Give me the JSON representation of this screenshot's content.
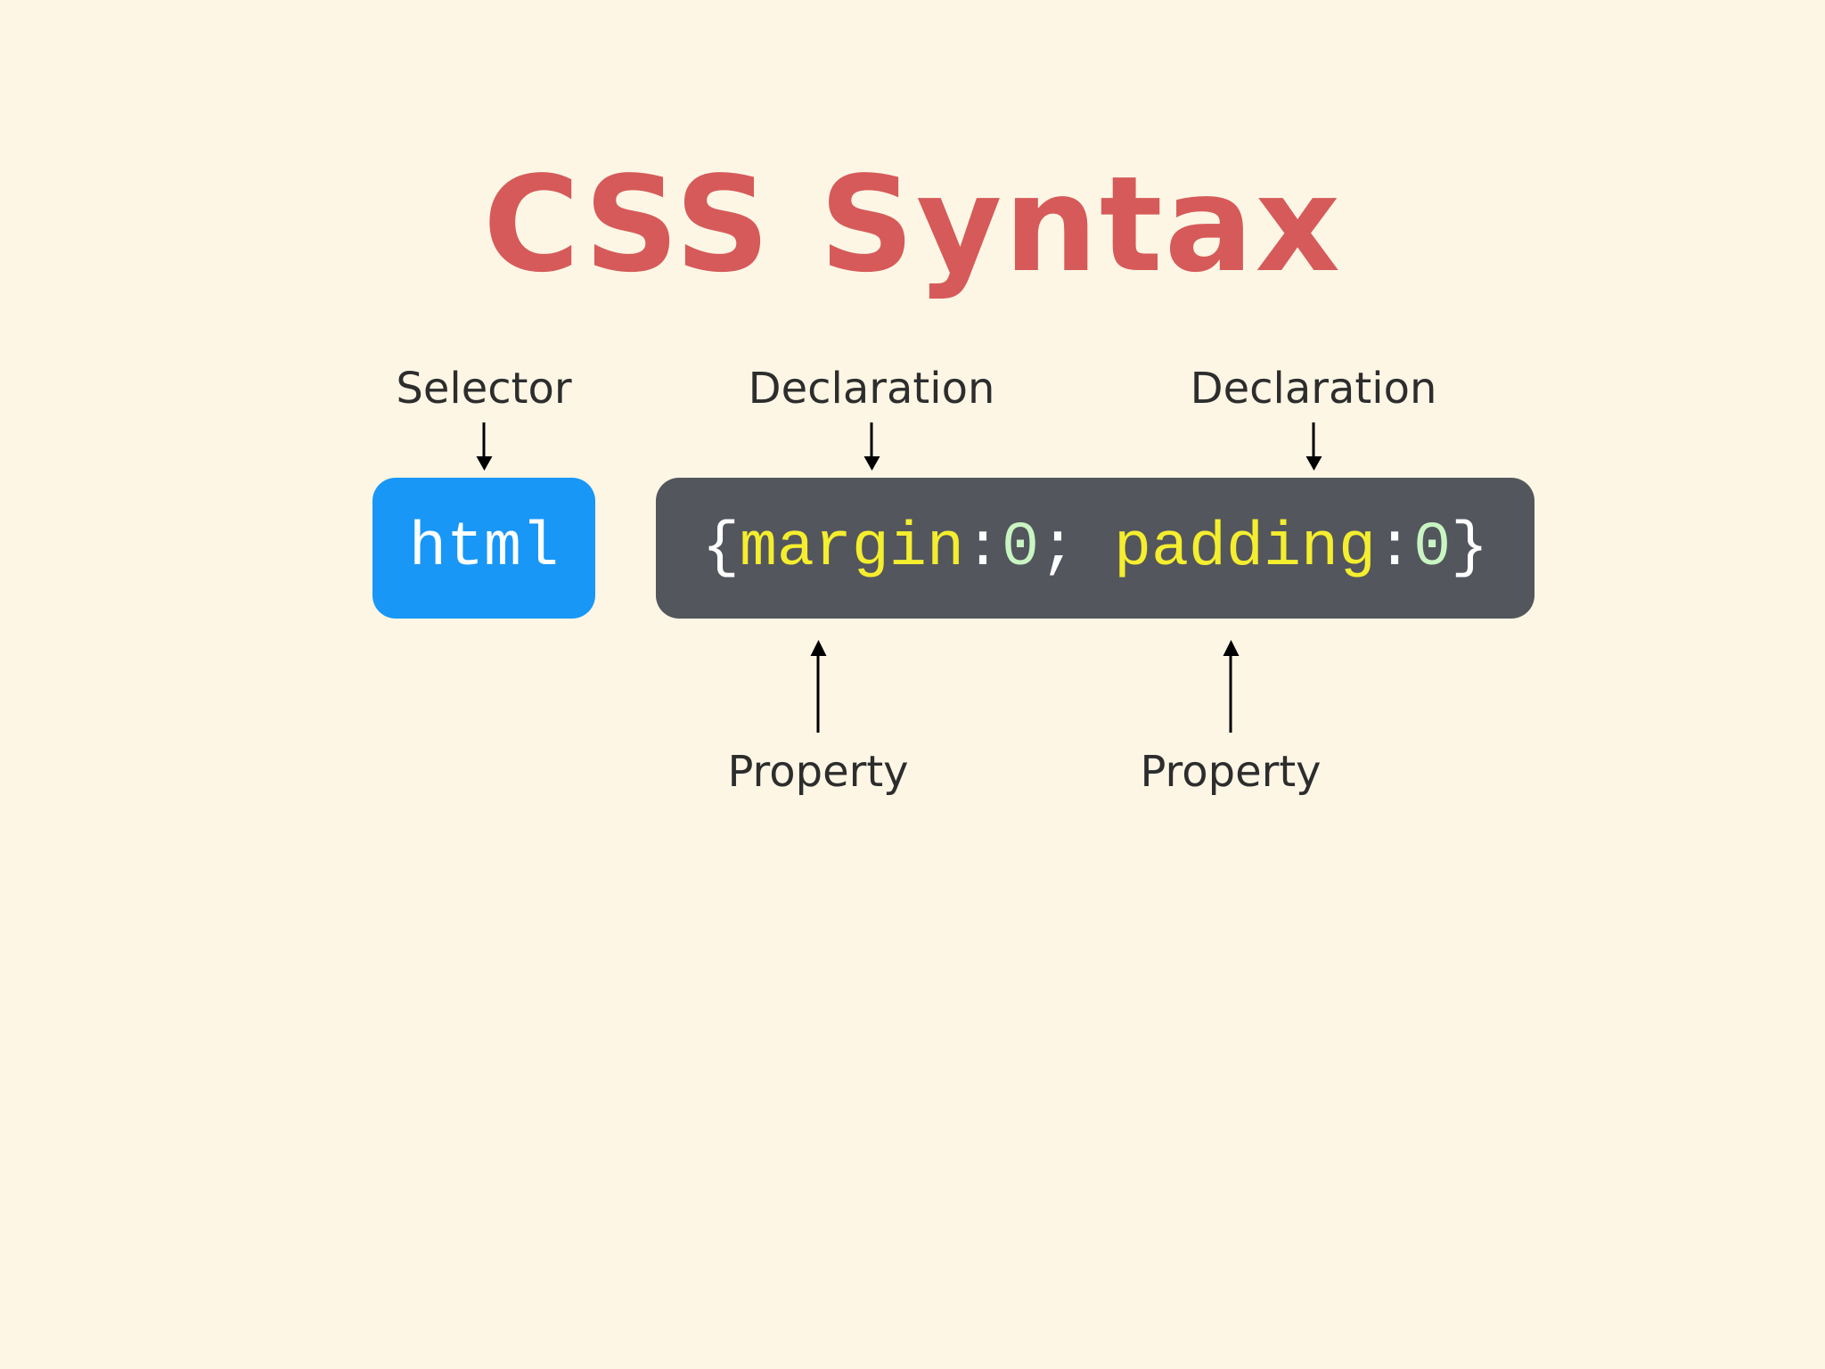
{
  "title": "CSS Syntax",
  "labels": {
    "selector": "Selector",
    "declaration_1": "Declaration",
    "declaration_2": "Declaration",
    "property_1": "Property",
    "property_2": "Property"
  },
  "selector_code": "html",
  "declaration_code": {
    "open_brace": "{",
    "property_1": "margin",
    "colon_1": ":",
    "value_1": "0",
    "semicolon": "; ",
    "property_2": "padding",
    "colon_2": ":",
    "value_2": "0",
    "close_brace": "}"
  },
  "colors": {
    "background": "#fdf6e5",
    "title": "#d65a59",
    "selector_box": "#1897f7",
    "code_box": "#53565d",
    "property_text": "#f5ee2e",
    "value_text": "#c9f5c3"
  }
}
